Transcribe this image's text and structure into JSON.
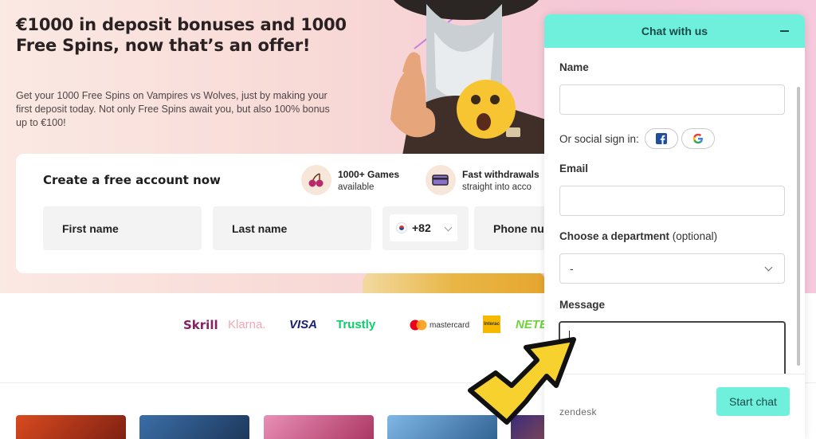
{
  "hero": {
    "title": "€1000 in deposit bonuses and 1000 Free Spins, now that’s an offer!",
    "text": "Get your 1000 Free Spins on Vampires vs Wolves, just by making your first deposit today. Not only Free Spins await you, but also 100% bonus up to €100!"
  },
  "signup": {
    "title": "Create a free account now",
    "features": [
      {
        "title": "1000+ Games",
        "sub": "available",
        "icon": "cherries-icon"
      },
      {
        "title": "Fast withdrawals",
        "sub": "straight into acco",
        "icon": "card-icon"
      }
    ],
    "first_name": "First name",
    "last_name": "Last name",
    "phone_code": "+82",
    "phone": "Phone nu"
  },
  "payments": [
    "Skrill",
    "Klarna.",
    "VISA",
    "Trustly",
    "mastercard",
    "Interac",
    "NETE"
  ],
  "chat": {
    "title": "Chat with us",
    "name_label": "Name",
    "social_label": "Or social sign in:",
    "email_label": "Email",
    "department_label": "Choose a department",
    "department_optional": "(optional)",
    "department_value": "-",
    "message_label": "Message",
    "branding": "zendesk",
    "start_label": "Start chat"
  },
  "colors": {
    "chat_accent": "#6ff0dd",
    "skrill": "#862165",
    "klarna": "#f3a7b8",
    "visa": "#1a1f71",
    "trustly": "#0ee06e"
  }
}
